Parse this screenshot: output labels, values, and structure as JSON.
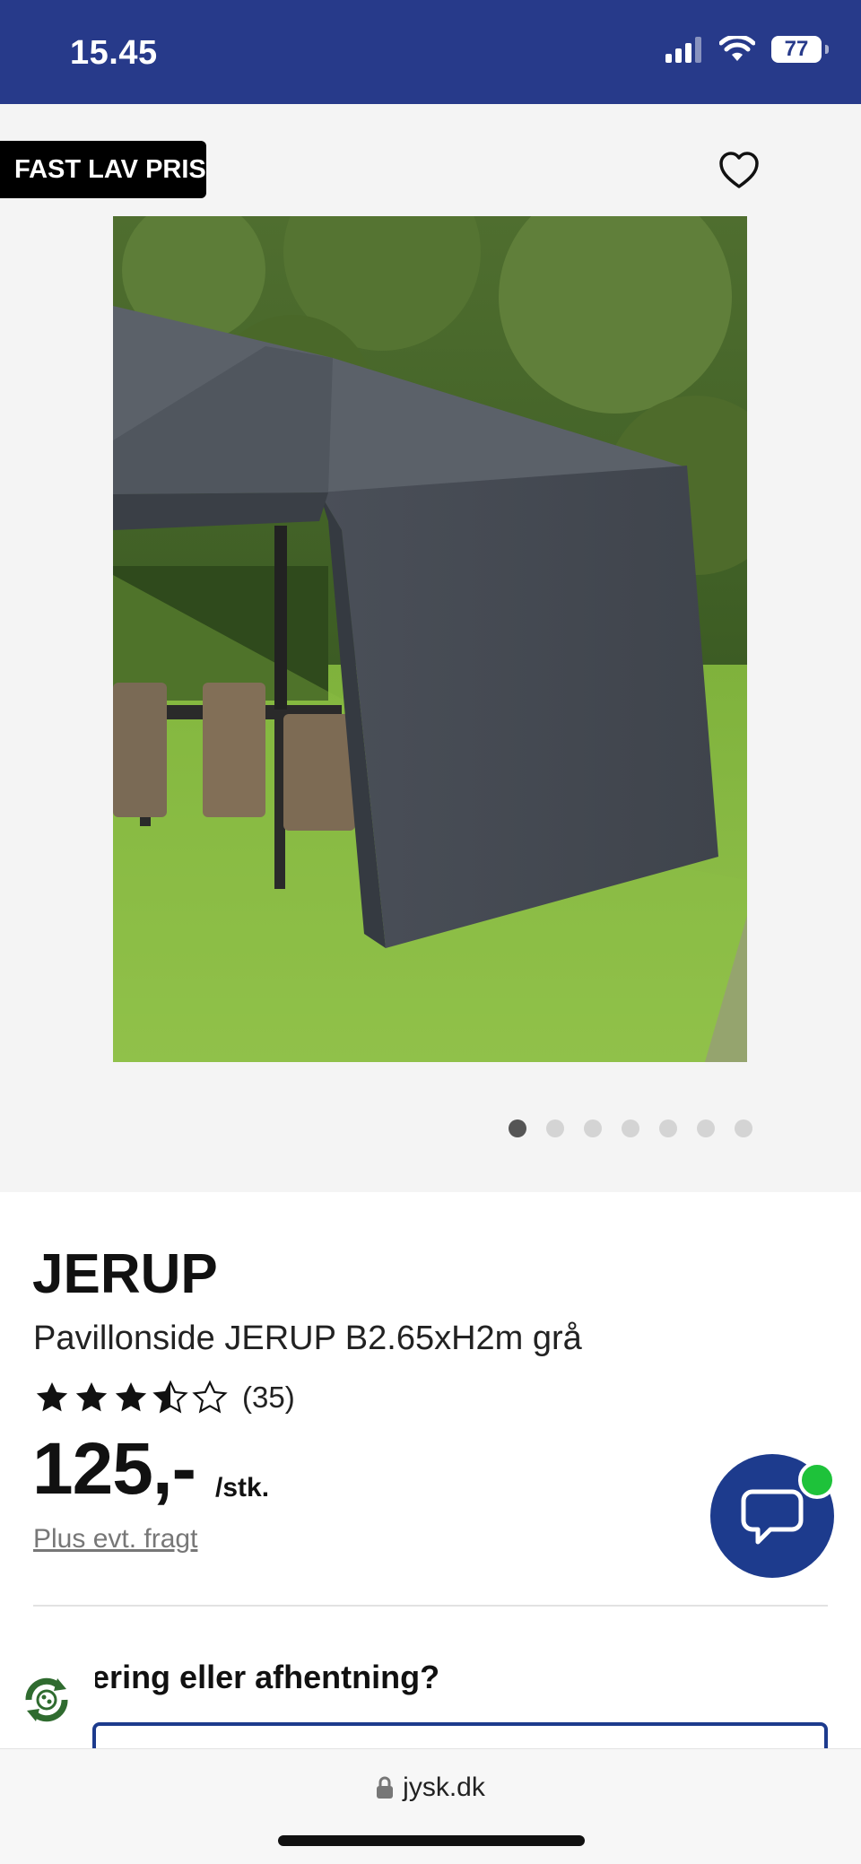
{
  "status_bar": {
    "time": "15.45",
    "battery": "77"
  },
  "gallery": {
    "badge": "FAST LAV PRIS",
    "dots_total": 7,
    "active_dot": 1
  },
  "product": {
    "brand": "JERUP",
    "name": "Pavillonside JERUP B2.65xH2m grå",
    "rating": 3.5,
    "rating_count": "(35)",
    "price": "125,-",
    "unit": "/stk.",
    "freight": "Plus evt. fragt",
    "delivery_heading": "Levering eller afhentning?"
  },
  "browser": {
    "url": "jysk.dk"
  },
  "colors": {
    "brand_blue": "#273a8a",
    "chat_blue": "#1d3b8d",
    "online_green": "#1ec23a"
  }
}
